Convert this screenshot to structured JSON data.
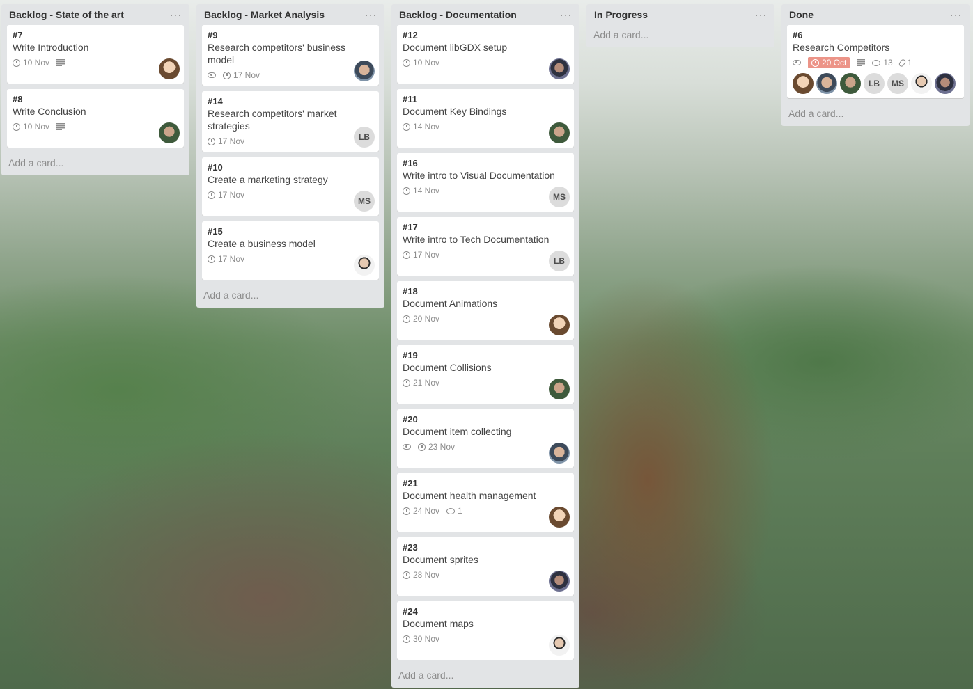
{
  "lists": [
    {
      "title": "Backlog - State of the art",
      "menu": "···",
      "add_card": "Add a card...",
      "cards": [
        {
          "num": "#7",
          "title": "Write Introduction",
          "watch": false,
          "date": "10 Nov",
          "date_late": false,
          "desc": true,
          "comments": "",
          "attachments": "",
          "members": [
            {
              "type": "photo",
              "style": "f"
            }
          ]
        },
        {
          "num": "#8",
          "title": "Write Conclusion",
          "watch": false,
          "date": "10 Nov",
          "date_late": false,
          "desc": true,
          "comments": "",
          "attachments": "",
          "members": [
            {
              "type": "photo",
              "style": "m2"
            }
          ]
        }
      ]
    },
    {
      "title": "Backlog - Market Analysis",
      "menu": "···",
      "add_card": "Add a card...",
      "cards": [
        {
          "num": "#9",
          "title": "Research competitors' business model",
          "watch": true,
          "date": "17 Nov",
          "date_late": false,
          "desc": false,
          "comments": "",
          "attachments": "",
          "members": [
            {
              "type": "photo",
              "style": "m1"
            }
          ]
        },
        {
          "num": "#14",
          "title": "Research competitors' market strategies",
          "watch": false,
          "date": "17 Nov",
          "date_late": false,
          "desc": false,
          "comments": "",
          "attachments": "",
          "members": [
            {
              "type": "initials",
              "text": "LB"
            }
          ]
        },
        {
          "num": "#10",
          "title": "Create a marketing strategy",
          "watch": false,
          "date": "17 Nov",
          "date_late": false,
          "desc": false,
          "comments": "",
          "attachments": "",
          "members": [
            {
              "type": "initials",
              "text": "MS"
            }
          ]
        },
        {
          "num": "#15",
          "title": "Create a business model",
          "watch": false,
          "date": "17 Nov",
          "date_late": false,
          "desc": false,
          "comments": "",
          "attachments": "",
          "members": [
            {
              "type": "photo",
              "style": "m3"
            }
          ]
        }
      ]
    },
    {
      "title": "Backlog - Documentation",
      "menu": "···",
      "add_card": "Add a card...",
      "cards": [
        {
          "num": "#12",
          "title": "Document libGDX setup",
          "watch": false,
          "date": "10 Nov",
          "date_late": false,
          "desc": false,
          "comments": "",
          "attachments": "",
          "members": [
            {
              "type": "photo",
              "style": "m4"
            }
          ]
        },
        {
          "num": "#11",
          "title": "Document Key Bindings",
          "watch": false,
          "date": "14 Nov",
          "date_late": false,
          "desc": false,
          "comments": "",
          "attachments": "",
          "members": [
            {
              "type": "photo",
              "style": "m2"
            }
          ]
        },
        {
          "num": "#16",
          "title": "Write intro to Visual Documentation",
          "watch": false,
          "date": "14 Nov",
          "date_late": false,
          "desc": false,
          "comments": "",
          "attachments": "",
          "members": [
            {
              "type": "initials",
              "text": "MS"
            }
          ]
        },
        {
          "num": "#17",
          "title": "Write intro to Tech Documentation",
          "watch": false,
          "date": "17 Nov",
          "date_late": false,
          "desc": false,
          "comments": "",
          "attachments": "",
          "members": [
            {
              "type": "initials",
              "text": "LB"
            }
          ]
        },
        {
          "num": "#18",
          "title": "Document Animations",
          "watch": false,
          "date": "20 Nov",
          "date_late": false,
          "desc": false,
          "comments": "",
          "attachments": "",
          "members": [
            {
              "type": "photo",
              "style": "f"
            }
          ]
        },
        {
          "num": "#19",
          "title": "Document Collisions",
          "watch": false,
          "date": "21 Nov",
          "date_late": false,
          "desc": false,
          "comments": "",
          "attachments": "",
          "members": [
            {
              "type": "photo",
              "style": "m2"
            }
          ]
        },
        {
          "num": "#20",
          "title": "Document item collecting",
          "watch": true,
          "date": "23 Nov",
          "date_late": false,
          "desc": false,
          "comments": "",
          "attachments": "",
          "members": [
            {
              "type": "photo",
              "style": "m1"
            }
          ]
        },
        {
          "num": "#21",
          "title": "Document health management",
          "watch": false,
          "date": "24 Nov",
          "date_late": false,
          "desc": false,
          "comments": "1",
          "attachments": "",
          "members": [
            {
              "type": "photo",
              "style": "f"
            }
          ]
        },
        {
          "num": "#23",
          "title": "Document sprites",
          "watch": false,
          "date": "28 Nov",
          "date_late": false,
          "desc": false,
          "comments": "",
          "attachments": "",
          "members": [
            {
              "type": "photo",
              "style": "m4"
            }
          ]
        },
        {
          "num": "#24",
          "title": "Document maps",
          "watch": false,
          "date": "30 Nov",
          "date_late": false,
          "desc": false,
          "comments": "",
          "attachments": "",
          "members": [
            {
              "type": "photo",
              "style": "m3"
            }
          ]
        }
      ]
    },
    {
      "title": "In Progress",
      "menu": "···",
      "add_card": "Add a card...",
      "cards": []
    },
    {
      "title": "Done",
      "menu": "···",
      "add_card": "Add a card...",
      "cards": [
        {
          "num": "#6",
          "title": "Research Competitors",
          "watch": true,
          "date": "20 Oct",
          "date_late": true,
          "desc": true,
          "comments": "13",
          "attachments": "1",
          "members_inline": true,
          "members": [
            {
              "type": "photo",
              "style": "f"
            },
            {
              "type": "photo",
              "style": "m1"
            },
            {
              "type": "photo",
              "style": "m2"
            },
            {
              "type": "initials",
              "text": "LB"
            },
            {
              "type": "initials",
              "text": "MS"
            },
            {
              "type": "photo",
              "style": "m3"
            },
            {
              "type": "photo",
              "style": "m4"
            }
          ]
        }
      ]
    }
  ]
}
